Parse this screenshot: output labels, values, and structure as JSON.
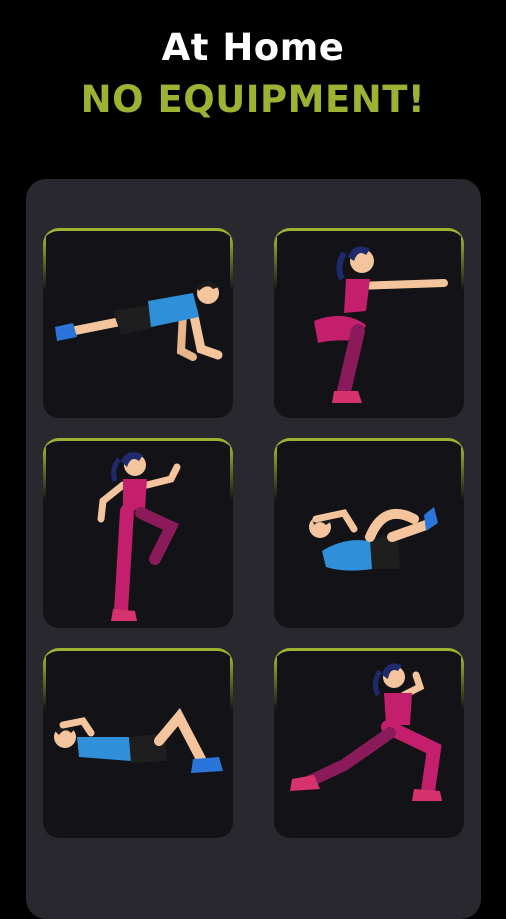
{
  "header": {
    "line1": "At Home",
    "line2": "NO EQUIPMENT!"
  },
  "colors": {
    "accent": "#9bb232",
    "card_background": "#121217",
    "panel_background": "#29282e",
    "page_background": "#000000"
  },
  "exercises": [
    {
      "icon": "push-up-icon"
    },
    {
      "icon": "squat-icon"
    },
    {
      "icon": "high-knee-icon"
    },
    {
      "icon": "bicycle-crunch-icon"
    },
    {
      "icon": "sit-up-icon"
    },
    {
      "icon": "lunge-icon"
    }
  ]
}
